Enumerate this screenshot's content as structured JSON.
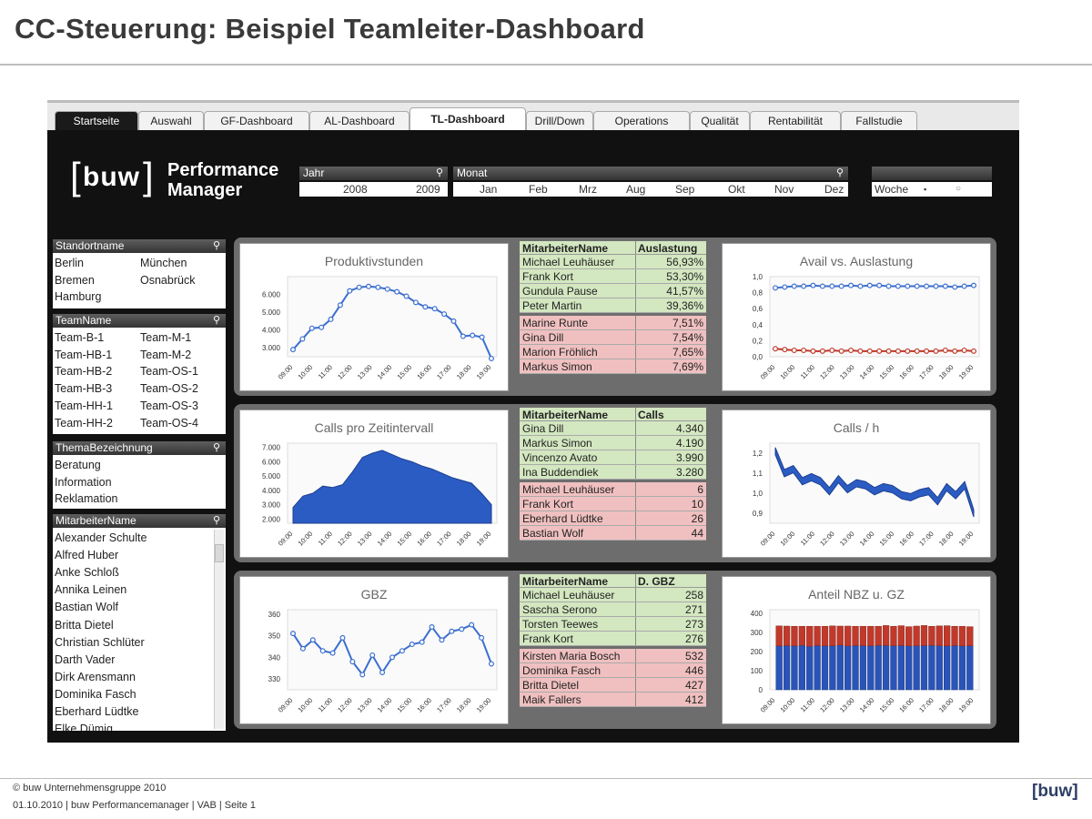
{
  "slide_title": "CC-Steuerung: Beispiel Teamleiter-Dashboard",
  "tabs": [
    "Startseite",
    "Auswahl",
    "GF-Dashboard",
    "AL-Dashboard",
    "TL-Dashboard",
    "Drill/Down",
    "Operations",
    "Qualität",
    "Rentabilität",
    "Fallstudie"
  ],
  "active_tab": "TL-Dashboard",
  "logo": {
    "bracket_text": "buw",
    "line1": "Performance",
    "line2": "Manager"
  },
  "selectors": {
    "year_label": "Jahr",
    "years": [
      "2008",
      "2009"
    ],
    "month_label": "Monat",
    "months": [
      "Jan",
      "Feb",
      "Mrz",
      "Aug",
      "Sep",
      "Okt",
      "Nov",
      "Dez"
    ],
    "week_label": "Woche",
    "week_arrow": "▪"
  },
  "lists": {
    "standort": {
      "title": "Standortname",
      "col1": [
        "Berlin",
        "Bremen",
        "Hamburg"
      ],
      "col2": [
        "München",
        "Osnabrück"
      ]
    },
    "team": {
      "title": "TeamName",
      "col1": [
        "Team-B-1",
        "Team-HB-1",
        "Team-HB-2",
        "Team-HB-3",
        "Team-HH-1",
        "Team-HH-2"
      ],
      "col2": [
        "Team-M-1",
        "Team-M-2",
        "Team-OS-1",
        "Team-OS-2",
        "Team-OS-3",
        "Team-OS-4"
      ]
    },
    "thema": {
      "title": "ThemaBezeichnung",
      "items": [
        "Beratung",
        "Information",
        "Reklamation"
      ]
    },
    "mitarbeiter": {
      "title": "MitarbeiterName",
      "items": [
        "Alexander Schulte",
        "Alfred Huber",
        "Anke Schloß",
        "Annika Leinen",
        "Bastian Wolf",
        "Britta Dietel",
        "Christian Schlüter",
        "Darth Vader",
        "Dirk Arensmann",
        "Dominika Fasch",
        "Eberhard Lüdtke",
        "Elke Dümig"
      ]
    }
  },
  "tables": [
    {
      "col1": "MitarbeiterName",
      "col2": "Auslastung",
      "green": [
        [
          "Michael Leuhäuser",
          "56,93%"
        ],
        [
          "Frank Kort",
          "53,30%"
        ],
        [
          "Gundula Pause",
          "41,57%"
        ],
        [
          "Peter Martin",
          "39,36%"
        ]
      ],
      "red": [
        [
          "Marine Runte",
          "7,51%"
        ],
        [
          "Gina Dill",
          "7,54%"
        ],
        [
          "Marion Fröhlich",
          "7,65%"
        ],
        [
          "Markus Simon",
          "7,69%"
        ]
      ]
    },
    {
      "col1": "MitarbeiterName",
      "col2": "Calls",
      "green": [
        [
          "Gina Dill",
          "4.340"
        ],
        [
          "Markus Simon",
          "4.190"
        ],
        [
          "Vincenzo Avato",
          "3.990"
        ],
        [
          "Ina Buddendiek",
          "3.280"
        ]
      ],
      "red": [
        [
          "Michael Leuhäuser",
          "6"
        ],
        [
          "Frank Kort",
          "10"
        ],
        [
          "Eberhard Lüdtke",
          "26"
        ],
        [
          "Bastian Wolf",
          "44"
        ]
      ]
    },
    {
      "col1": "MitarbeiterName",
      "col2": "D. GBZ",
      "green": [
        [
          "Michael Leuhäuser",
          "258"
        ],
        [
          "Sascha Serono",
          "271"
        ],
        [
          "Torsten Teewes",
          "273"
        ],
        [
          "Frank Kort",
          "276"
        ]
      ],
      "red": [
        [
          "Kirsten Maria Bosch",
          "532"
        ],
        [
          "Dominika Fasch",
          "446"
        ],
        [
          "Britta Dietel",
          "427"
        ],
        [
          "Maik Fallers",
          "412"
        ]
      ]
    }
  ],
  "chart_data": [
    {
      "type": "line",
      "title": "Produktivstunden",
      "x": [
        "09:00",
        "10:00",
        "11:00",
        "12:00",
        "13:00",
        "14:00",
        "15:00",
        "16:00",
        "17:00",
        "18:00",
        "19:00"
      ],
      "yticks": [
        "3.000",
        "4.000",
        "5.000",
        "6.000"
      ],
      "ylim": [
        2500,
        7000
      ],
      "values": [
        2900,
        3500,
        4100,
        4150,
        4600,
        5400,
        6200,
        6400,
        6450,
        6400,
        6300,
        6150,
        5900,
        5550,
        5300,
        5200,
        4900,
        4500,
        3650,
        3700,
        3600,
        2400
      ]
    },
    {
      "type": "line",
      "title": "Avail vs. Auslastung",
      "x": [
        "09:00",
        "10:00",
        "11:00",
        "12:00",
        "13:00",
        "14:00",
        "15:00",
        "16:00",
        "17:00",
        "18:00",
        "19:00"
      ],
      "yticks": [
        "0,0",
        "0,2",
        "0,4",
        "0,6",
        "0,8",
        "1,0"
      ],
      "ylim": [
        0,
        1
      ],
      "series": [
        {
          "values": [
            0.86,
            0.87,
            0.88,
            0.88,
            0.89,
            0.88,
            0.88,
            0.88,
            0.89,
            0.88,
            0.89,
            0.89,
            0.88,
            0.88,
            0.88,
            0.88,
            0.88,
            0.88,
            0.88,
            0.87,
            0.88,
            0.89
          ]
        },
        {
          "values": [
            0.1,
            0.09,
            0.08,
            0.08,
            0.07,
            0.07,
            0.08,
            0.07,
            0.08,
            0.07,
            0.07,
            0.07,
            0.07,
            0.07,
            0.07,
            0.07,
            0.07,
            0.07,
            0.08,
            0.07,
            0.08,
            0.07
          ]
        }
      ]
    },
    {
      "type": "area",
      "title": "Calls pro Zeitintervall",
      "x": [
        "09:00",
        "10:00",
        "11:00",
        "12:00",
        "13:00",
        "14:00",
        "15:00",
        "16:00",
        "17:00",
        "18:00",
        "19:00"
      ],
      "yticks": [
        "2.000",
        "3.000",
        "4.000",
        "5.000",
        "6.000",
        "7.000"
      ],
      "ylim": [
        1700,
        7300
      ],
      "values": [
        2800,
        3600,
        3800,
        4300,
        4200,
        4400,
        5300,
        6300,
        6600,
        6800,
        6500,
        6200,
        6000,
        5700,
        5500,
        5200,
        4900,
        4700,
        4500,
        3800,
        3000
      ]
    },
    {
      "type": "line",
      "title": "Calls  / h",
      "x": [
        "09:00",
        "10:00",
        "11:00",
        "12:00",
        "13:00",
        "14:00",
        "15:00",
        "16:00",
        "17:00",
        "18:00",
        "19:00"
      ],
      "yticks": [
        "0,9",
        "1,0",
        "1,1",
        "1,2"
      ],
      "ylim": [
        0.85,
        1.25
      ],
      "values": [
        1.21,
        1.1,
        1.12,
        1.06,
        1.08,
        1.06,
        1.01,
        1.07,
        1.02,
        1.05,
        1.04,
        1.01,
        1.03,
        1.02,
        0.99,
        0.98,
        1.0,
        1.01,
        0.96,
        1.03,
        0.99,
        1.04,
        0.9
      ]
    },
    {
      "type": "line",
      "title": "GBZ",
      "x": [
        "09:00",
        "10:00",
        "11:00",
        "12:00",
        "13:00",
        "14:00",
        "15:00",
        "16:00",
        "17:00",
        "18:00",
        "19:00"
      ],
      "yticks": [
        "330",
        "340",
        "350",
        "360"
      ],
      "ylim": [
        325,
        362
      ],
      "values": [
        351,
        344,
        348,
        343,
        342,
        349,
        338,
        332,
        341,
        333,
        340,
        343,
        346,
        347,
        354,
        348,
        352,
        353,
        355,
        349,
        337
      ]
    },
    {
      "type": "bar",
      "title": "Anteil NBZ u. GZ",
      "x": [
        "09:00",
        "10:00",
        "11:00",
        "12:00",
        "13:00",
        "14:00",
        "15:00",
        "16:00",
        "17:00",
        "18:00",
        "19:00"
      ],
      "yticks": [
        "0",
        "100",
        "200",
        "300",
        "400"
      ],
      "ylim": [
        0,
        420
      ],
      "series": [
        {
          "values": [
            230,
            232,
            230,
            233,
            228,
            232,
            230,
            231,
            234,
            230,
            232,
            231,
            230,
            233,
            232,
            231,
            232,
            230,
            231,
            232,
            233,
            231,
            230,
            232,
            230,
            231
          ]
        },
        {
          "values": [
            105,
            102,
            103,
            100,
            105,
            101,
            103,
            104,
            100,
            104,
            101,
            102,
            103,
            100,
            105,
            102,
            104,
            101,
            103,
            105,
            100,
            104,
            106,
            101,
            103,
            100
          ]
        }
      ]
    }
  ],
  "footer": {
    "line1": "© buw Unternehmensgruppe 2010",
    "line2": "01.10.2010 | buw Performancemanager | VAB | Seite 1"
  },
  "corner_logo": "[buw]",
  "colors": {
    "line_blue": "#3c6fd0",
    "area_blue": "#2b5cc4",
    "bar_red": "#c0392b",
    "green_row": "#d3e7c0",
    "red_row": "#f0c0c0"
  }
}
